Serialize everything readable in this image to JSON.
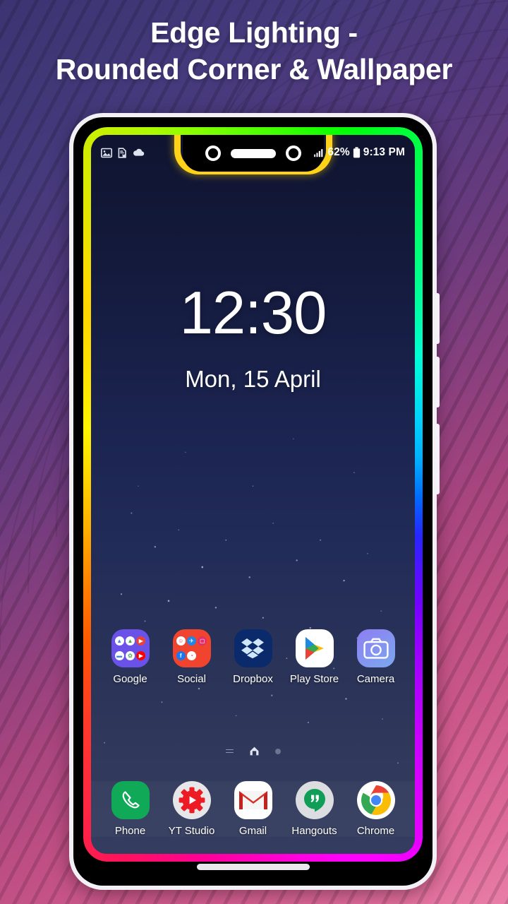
{
  "promo": {
    "title_line1": "Edge Lighting -",
    "title_line2": "Rounded Corner & Wallpaper",
    "bg_color_top": "#3b3472",
    "bg_color_bottom": "#e87fa8"
  },
  "phone": {
    "frame_color": "#f2f0f4",
    "body_color": "#000000",
    "edge_light_colors": [
      "#ffd400",
      "#2bff2b",
      "#00f0d0",
      "#2a2aff",
      "#c400ff",
      "#ff00b4",
      "#ff5a1f",
      "#ffb400"
    ],
    "side_buttons": [
      "volume-up",
      "volume-down",
      "power"
    ],
    "notch": {
      "cameras": 2,
      "speaker": "earpiece-speaker",
      "ring_color": "#ffd21a"
    },
    "home_indicator": "gesture-bar"
  },
  "statusbar": {
    "left_icons": [
      "image-icon",
      "document-error-icon",
      "cloud-icon"
    ],
    "signal_icon": "signal-bars-icon",
    "battery_percent": "62%",
    "battery_icon": "battery-icon",
    "time": "9:13 PM"
  },
  "lockscreen": {
    "clock": "12:30",
    "date": "Mon, 15 April"
  },
  "homescreen": {
    "wallpaper": "dark-blue-starfield",
    "apps": [
      {
        "name": "Google",
        "icon": "google-folder-icon",
        "type": "folder",
        "bg": "#6a52e8",
        "mini": [
          {
            "bg": "#ffffff",
            "glyph": "△",
            "color": "#4285f4"
          },
          {
            "bg": "#ffffff",
            "glyph": "△",
            "color": "#34a853"
          },
          {
            "bg": "#ea4335",
            "glyph": "▶",
            "color": "#ffffff"
          },
          {
            "bg": "#ffffff",
            "glyph": "▬",
            "color": "#4285f4"
          },
          {
            "bg": "#ffffff",
            "glyph": "✿",
            "color": "#34a853"
          },
          {
            "bg": "#ff0000",
            "glyph": "▶",
            "color": "#ffffff"
          }
        ]
      },
      {
        "name": "Social",
        "icon": "social-folder-icon",
        "type": "folder",
        "bg": "#f0442e",
        "mini": [
          {
            "bg": "#ffffff",
            "glyph": "☺",
            "color": "#ff3b30"
          },
          {
            "bg": "#1e88e5",
            "glyph": "✈",
            "color": "#ffffff"
          },
          {
            "bg": "#e1306c",
            "glyph": "▢",
            "color": "#ffffff"
          },
          {
            "bg": "#1877f2",
            "glyph": "f",
            "color": "#ffffff"
          },
          {
            "bg": "#ffffff",
            "glyph": "◔",
            "color": "#e4405f"
          },
          {
            "bg": "transparent",
            "glyph": "",
            "color": "#ffffff"
          }
        ]
      },
      {
        "name": "Dropbox",
        "icon": "dropbox-icon",
        "type": "app",
        "bg": "#0a2a6b"
      },
      {
        "name": "Play Store",
        "icon": "play-store-icon",
        "type": "app",
        "bg": "#ffffff"
      },
      {
        "name": "Camera",
        "icon": "camera-icon",
        "type": "app",
        "bg": "#7e8cf0"
      }
    ],
    "page_indicator": {
      "icons": [
        "list-icon",
        "home-icon",
        "page-dot-icon"
      ],
      "active": "home-icon"
    },
    "dock": [
      {
        "name": "Phone",
        "icon": "phone-icon",
        "bg": "#0fa958"
      },
      {
        "name": "YT Studio",
        "icon": "yt-studio-icon",
        "bg": "#e7e7e9"
      },
      {
        "name": "Gmail",
        "icon": "gmail-icon",
        "bg": "#ffffff"
      },
      {
        "name": "Hangouts",
        "icon": "hangouts-icon",
        "bg": "#dcdde0"
      },
      {
        "name": "Chrome",
        "icon": "chrome-icon",
        "bg": "#ffffff"
      }
    ]
  }
}
